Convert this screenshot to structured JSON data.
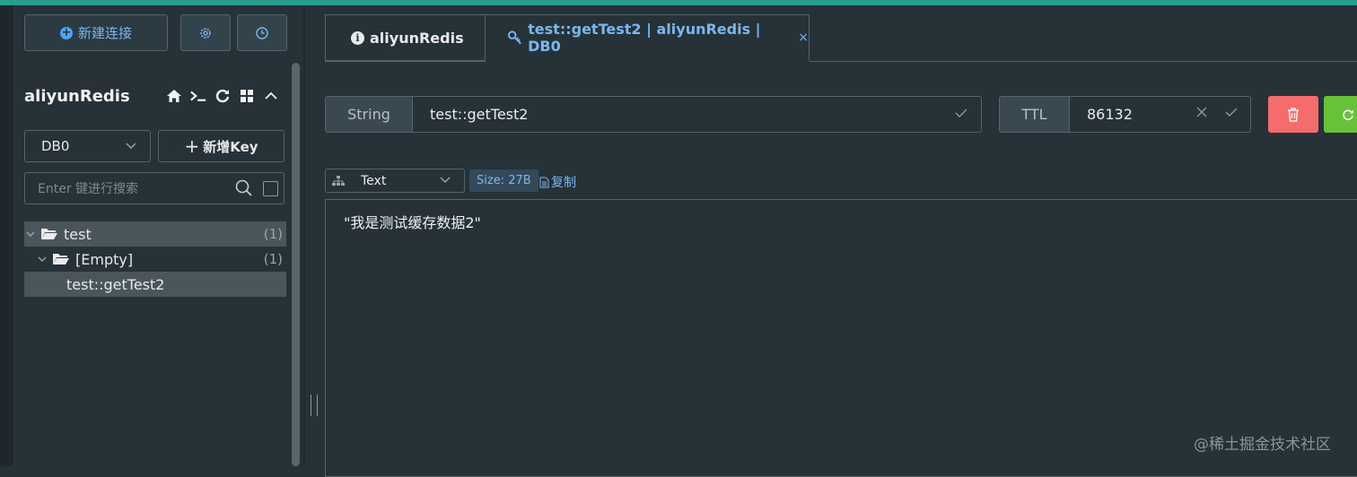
{
  "sidebar": {
    "new_connection_label": "新建连接",
    "connection_name": "aliyunRedis",
    "db_selected": "DB0",
    "add_key_label": "新增Key",
    "search_placeholder": "Enter 键进行搜索",
    "tree": {
      "folder": {
        "name": "test",
        "count": "(1)"
      },
      "subfolder": {
        "name": "[Empty]",
        "count": "(1)"
      },
      "key": {
        "name": "test::getTest2"
      }
    }
  },
  "tabs": [
    {
      "label": "aliyunRedis"
    },
    {
      "label": "test::getTest2 | aliyunRedis | DB0",
      "close": "×"
    }
  ],
  "key_bar": {
    "type": "String",
    "key_name": "test::getTest2",
    "ttl_label": "TTL",
    "ttl_value": "86132"
  },
  "viewer": {
    "format": "Text",
    "size": "Size: 27B",
    "copy_label": "复制",
    "value": "\"我是测试缓存数据2\""
  },
  "watermark": "@稀土掘金技术社区",
  "colors": {
    "accent_blue": "#7bb6ee",
    "delete_red": "#f56c6c",
    "refresh_green": "#67c23a",
    "top_bar": "#2a9d8f"
  }
}
